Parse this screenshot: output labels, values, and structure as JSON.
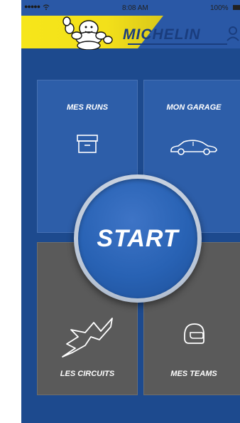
{
  "status_bar": {
    "signal": "●●●●●",
    "wifi": "wifi-icon",
    "time": "8:08 AM",
    "battery": "100%"
  },
  "header": {
    "brand": "MICHELIN",
    "logo": "bibendum-mascot",
    "user_icon": "user-icon",
    "colors": {
      "banner": "#f3e01a",
      "brand_text": "#1a3d7e",
      "header_bg": "#2a58a6"
    }
  },
  "tiles": {
    "runs": {
      "label": "MES RUNS",
      "icon": "archive-box-icon"
    },
    "garage": {
      "label": "MON GARAGE",
      "icon": "car-icon"
    },
    "circuits": {
      "label": "LES CIRCUITS",
      "icon": "circuit-track-icon"
    },
    "teams": {
      "label": "MES TEAMS",
      "icon": "helmet-icon"
    }
  },
  "start": {
    "label": "START"
  },
  "colors": {
    "background": "#1d4a8e",
    "tile_blue": "#2d5ea9",
    "tile_grey": "#5a5a5a",
    "start": "#2862b4"
  }
}
